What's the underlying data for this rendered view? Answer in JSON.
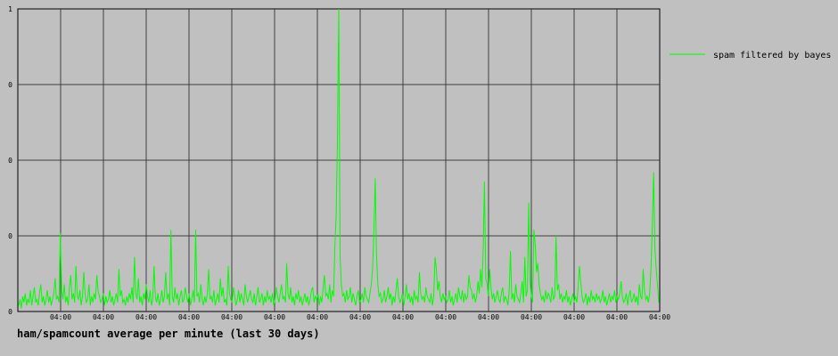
{
  "chart_data": {
    "type": "line",
    "title": "ham/spamcount average per minute (last 30 days)",
    "xlabel": "",
    "ylabel": "",
    "grid": true,
    "legend_position": "right",
    "x_tick_labels": [
      "04:00",
      "04:00",
      "04:00",
      "04:00",
      "04:00",
      "04:00",
      "04:00",
      "04:00",
      "04:00",
      "04:00",
      "04:00",
      "04:00",
      "04:00",
      "04:00",
      "04:00"
    ],
    "y_tick_labels": [
      "0",
      "0",
      "0",
      "0",
      "1"
    ],
    "ylim": [
      0,
      1
    ],
    "series": [
      {
        "name": "spam filtered by bayes",
        "color": "#00ff00",
        "values": [
          0.02,
          0.04,
          0.01,
          0.05,
          0.03,
          0.06,
          0.02,
          0.04,
          0.03,
          0.07,
          0.02,
          0.05,
          0.08,
          0.03,
          0.04,
          0.02,
          0.06,
          0.09,
          0.03,
          0.05,
          0.02,
          0.04,
          0.07,
          0.03,
          0.05,
          0.02,
          0.04,
          0.06,
          0.11,
          0.04,
          0.05,
          0.03,
          0.26,
          0.07,
          0.04,
          0.09,
          0.03,
          0.05,
          0.02,
          0.08,
          0.12,
          0.04,
          0.06,
          0.03,
          0.15,
          0.05,
          0.04,
          0.07,
          0.02,
          0.05,
          0.13,
          0.06,
          0.03,
          0.04,
          0.09,
          0.02,
          0.05,
          0.03,
          0.06,
          0.04,
          0.12,
          0.07,
          0.05,
          0.03,
          0.04,
          0.06,
          0.02,
          0.05,
          0.03,
          0.04,
          0.07,
          0.03,
          0.05,
          0.02,
          0.04,
          0.06,
          0.03,
          0.14,
          0.05,
          0.07,
          0.03,
          0.04,
          0.02,
          0.05,
          0.03,
          0.06,
          0.04,
          0.08,
          0.03,
          0.18,
          0.06,
          0.04,
          0.11,
          0.03,
          0.05,
          0.02,
          0.06,
          0.04,
          0.09,
          0.05,
          0.03,
          0.07,
          0.02,
          0.04,
          0.15,
          0.05,
          0.03,
          0.06,
          0.02,
          0.04,
          0.07,
          0.03,
          0.05,
          0.13,
          0.04,
          0.06,
          0.02,
          0.27,
          0.05,
          0.03,
          0.08,
          0.04,
          0.06,
          0.02,
          0.05,
          0.07,
          0.03,
          0.04,
          0.08,
          0.05,
          0.03,
          0.06,
          0.02,
          0.04,
          0.07,
          0.03,
          0.27,
          0.05,
          0.06,
          0.03,
          0.09,
          0.04,
          0.02,
          0.05,
          0.03,
          0.06,
          0.14,
          0.04,
          0.05,
          0.03,
          0.07,
          0.02,
          0.04,
          0.06,
          0.03,
          0.11,
          0.05,
          0.08,
          0.03,
          0.04,
          0.02,
          0.15,
          0.06,
          0.04,
          0.03,
          0.08,
          0.05,
          0.02,
          0.04,
          0.07,
          0.03,
          0.06,
          0.04,
          0.02,
          0.09,
          0.05,
          0.03,
          0.05,
          0.07,
          0.04,
          0.03,
          0.06,
          0.02,
          0.05,
          0.08,
          0.03,
          0.04,
          0.06,
          0.02,
          0.05,
          0.03,
          0.07,
          0.04,
          0.05,
          0.03,
          0.06,
          0.02,
          0.04,
          0.08,
          0.05,
          0.03,
          0.06,
          0.09,
          0.04,
          0.05,
          0.03,
          0.16,
          0.06,
          0.04,
          0.08,
          0.03,
          0.05,
          0.02,
          0.06,
          0.04,
          0.07,
          0.03,
          0.05,
          0.02,
          0.04,
          0.06,
          0.03,
          0.05,
          0.02,
          0.04,
          0.07,
          0.08,
          0.03,
          0.05,
          0.04,
          0.06,
          0.02,
          0.05,
          0.03,
          0.08,
          0.12,
          0.05,
          0.06,
          0.04,
          0.09,
          0.03,
          0.07,
          0.05,
          0.21,
          0.32,
          0.56,
          1.0,
          0.18,
          0.09,
          0.05,
          0.06,
          0.03,
          0.07,
          0.04,
          0.05,
          0.08,
          0.03,
          0.06,
          0.04,
          0.02,
          0.05,
          0.07,
          0.03,
          0.04,
          0.06,
          0.03,
          0.08,
          0.05,
          0.04,
          0.03,
          0.06,
          0.09,
          0.14,
          0.26,
          0.44,
          0.19,
          0.09,
          0.05,
          0.06,
          0.03,
          0.04,
          0.07,
          0.03,
          0.05,
          0.08,
          0.04,
          0.06,
          0.02,
          0.05,
          0.03,
          0.07,
          0.11,
          0.05,
          0.03,
          0.04,
          0.06,
          0.02,
          0.05,
          0.09,
          0.04,
          0.06,
          0.03,
          0.05,
          0.02,
          0.07,
          0.04,
          0.05,
          0.03,
          0.13,
          0.06,
          0.04,
          0.05,
          0.03,
          0.08,
          0.05,
          0.04,
          0.03,
          0.06,
          0.02,
          0.05,
          0.18,
          0.14,
          0.07,
          0.1,
          0.05,
          0.03,
          0.06,
          0.04,
          0.05,
          0.03,
          0.04,
          0.07,
          0.03,
          0.05,
          0.02,
          0.04,
          0.06,
          0.03,
          0.08,
          0.05,
          0.04,
          0.07,
          0.03,
          0.06,
          0.04,
          0.05,
          0.12,
          0.08,
          0.07,
          0.04,
          0.06,
          0.03,
          0.05,
          0.1,
          0.06,
          0.14,
          0.08,
          0.2,
          0.43,
          0.11,
          0.09,
          0.05,
          0.14,
          0.08,
          0.04,
          0.06,
          0.03,
          0.05,
          0.07,
          0.04,
          0.03,
          0.06,
          0.08,
          0.03,
          0.05,
          0.04,
          0.02,
          0.07,
          0.2,
          0.04,
          0.06,
          0.03,
          0.09,
          0.05,
          0.04,
          0.03,
          0.06,
          0.1,
          0.03,
          0.18,
          0.05,
          0.07,
          0.36,
          0.1,
          0.05,
          0.03,
          0.27,
          0.22,
          0.13,
          0.16,
          0.09,
          0.06,
          0.04,
          0.05,
          0.03,
          0.07,
          0.04,
          0.06,
          0.05,
          0.03,
          0.08,
          0.04,
          0.05,
          0.25,
          0.07,
          0.09,
          0.04,
          0.06,
          0.03,
          0.05,
          0.04,
          0.07,
          0.03,
          0.05,
          0.02,
          0.04,
          0.06,
          0.03,
          0.05,
          0.03,
          0.08,
          0.15,
          0.1,
          0.05,
          0.03,
          0.04,
          0.06,
          0.02,
          0.05,
          0.03,
          0.07,
          0.04,
          0.05,
          0.03,
          0.06,
          0.04,
          0.05,
          0.03,
          0.04,
          0.07,
          0.03,
          0.05,
          0.02,
          0.04,
          0.06,
          0.03,
          0.05,
          0.04,
          0.07,
          0.03,
          0.05,
          0.04,
          0.06,
          0.1,
          0.05,
          0.03,
          0.04,
          0.06,
          0.02,
          0.05,
          0.07,
          0.03,
          0.04,
          0.06,
          0.03,
          0.05,
          0.02,
          0.09,
          0.05,
          0.04,
          0.14,
          0.07,
          0.04,
          0.05,
          0.03,
          0.06,
          0.14,
          0.28,
          0.46,
          0.21,
          0.14,
          0.09,
          0.03
        ]
      }
    ]
  }
}
